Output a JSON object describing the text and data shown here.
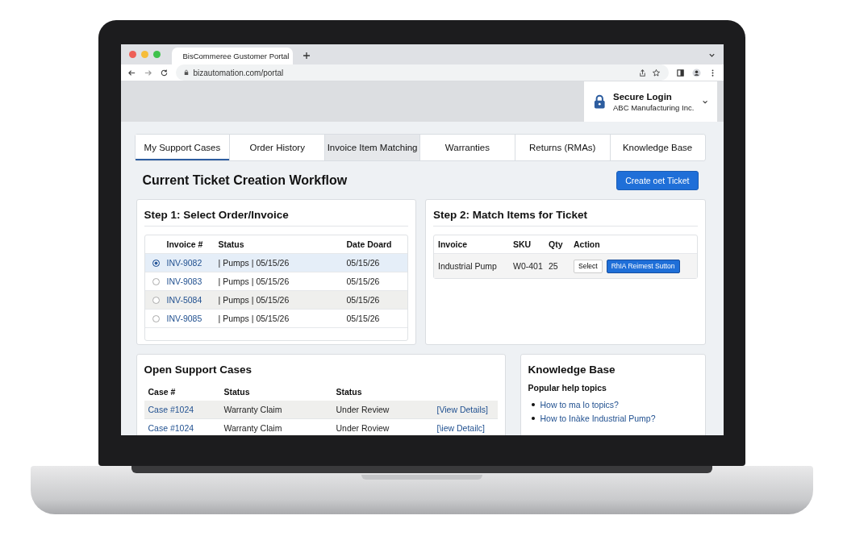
{
  "browser": {
    "tab_title": "BisCommeree Gustomer Portal",
    "url": "bizautomation.com/portal"
  },
  "account": {
    "title": "Secure Login",
    "org": "ABC Manufacturing Inc."
  },
  "nav_tabs": [
    {
      "label": "My Support Cases",
      "selected": true,
      "hovered": false
    },
    {
      "label": "Order History",
      "selected": false,
      "hovered": false
    },
    {
      "label": "Invoice Item Matching",
      "selected": false,
      "hovered": true
    },
    {
      "label": "Warranties",
      "selected": false,
      "hovered": false
    },
    {
      "label": "Returns (RMAs)",
      "selected": false,
      "hovered": false
    },
    {
      "label": "Knowledge Base",
      "selected": false,
      "hovered": false
    }
  ],
  "heading": "Current Ticket Creation Workflow",
  "create_button": "Create oet Ticket",
  "step1": {
    "title": "Step 1: Select Order/Invoice",
    "columns": [
      "Invoice #",
      "Status",
      "Date Doard"
    ],
    "rows": [
      {
        "invoice": "INV-9082",
        "status": "| Pumps | 05/15/26",
        "date": "05/15/26",
        "selected": true,
        "shaded": false
      },
      {
        "invoice": "INV-9083",
        "status": "| Pumps | 05/15/26",
        "date": "05/15/26",
        "selected": false,
        "shaded": false
      },
      {
        "invoice": "INV-5084",
        "status": "| Pumps | 05/15/26",
        "date": "05/15/26",
        "selected": false,
        "shaded": true
      },
      {
        "invoice": "INV-9085",
        "status": "| Pumps | 05/15/26",
        "date": "05/15/26",
        "selected": false,
        "shaded": false
      }
    ]
  },
  "step2": {
    "title": "Step 2: Match Items for Ticket",
    "columns": [
      "Invoice",
      "SKU",
      "Qty",
      "Action"
    ],
    "rows": [
      {
        "invoice": "Industrial Pump",
        "sku": "W0-401",
        "qty": "25",
        "select_button": "Select",
        "request_button": "RhIA Reimest Sutton"
      }
    ]
  },
  "cases": {
    "title": "Open Support Cases",
    "columns": [
      "Case #",
      "Status",
      "Status"
    ],
    "rows": [
      {
        "case": "Case #1024",
        "type": "Warranty Claim",
        "status": "Under Review",
        "link": "[View Details]",
        "shaded": true
      },
      {
        "case": "Case #1024",
        "type": "Warranty Claim",
        "status": "Under Roview",
        "link": "[\\iew Detailc]",
        "shaded": false
      }
    ]
  },
  "kb": {
    "title": "Knowledge Base",
    "subtitle": "Popular help topics",
    "links": [
      "How to ma lo topics?",
      "How to Inàke Industrial Pump?"
    ]
  }
}
